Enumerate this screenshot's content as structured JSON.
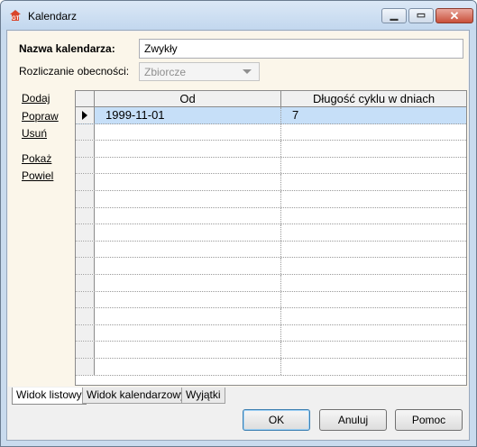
{
  "window": {
    "title": "Kalendarz"
  },
  "titlebar": {
    "min_glyph": "▁",
    "max_glyph": "▭",
    "close_glyph": "✕"
  },
  "form": {
    "name_label": "Nazwa kalendarza:",
    "name_value": "Zwykły",
    "settlement_label": "Rozliczanie obecności:",
    "settlement_value": "Zbiorcze"
  },
  "side_actions": [
    "Dodaj",
    "Popraw",
    "Usuń",
    "Pokaż",
    "Powiel"
  ],
  "grid": {
    "columns": [
      "Od",
      "Długość cyklu w dniach"
    ],
    "rows": [
      {
        "od": "1999-11-01",
        "dlugosc": "7",
        "selected": true
      }
    ]
  },
  "tabs": [
    "Widok listowy",
    "Widok kalendarzowy",
    "Wyjątki"
  ],
  "buttons": {
    "ok": "OK",
    "cancel": "Anuluj",
    "help": "Pomoc"
  },
  "colors": {
    "accent": "#c6dff8",
    "panel": "#fbf6ea",
    "frame": "#c9dbee"
  }
}
